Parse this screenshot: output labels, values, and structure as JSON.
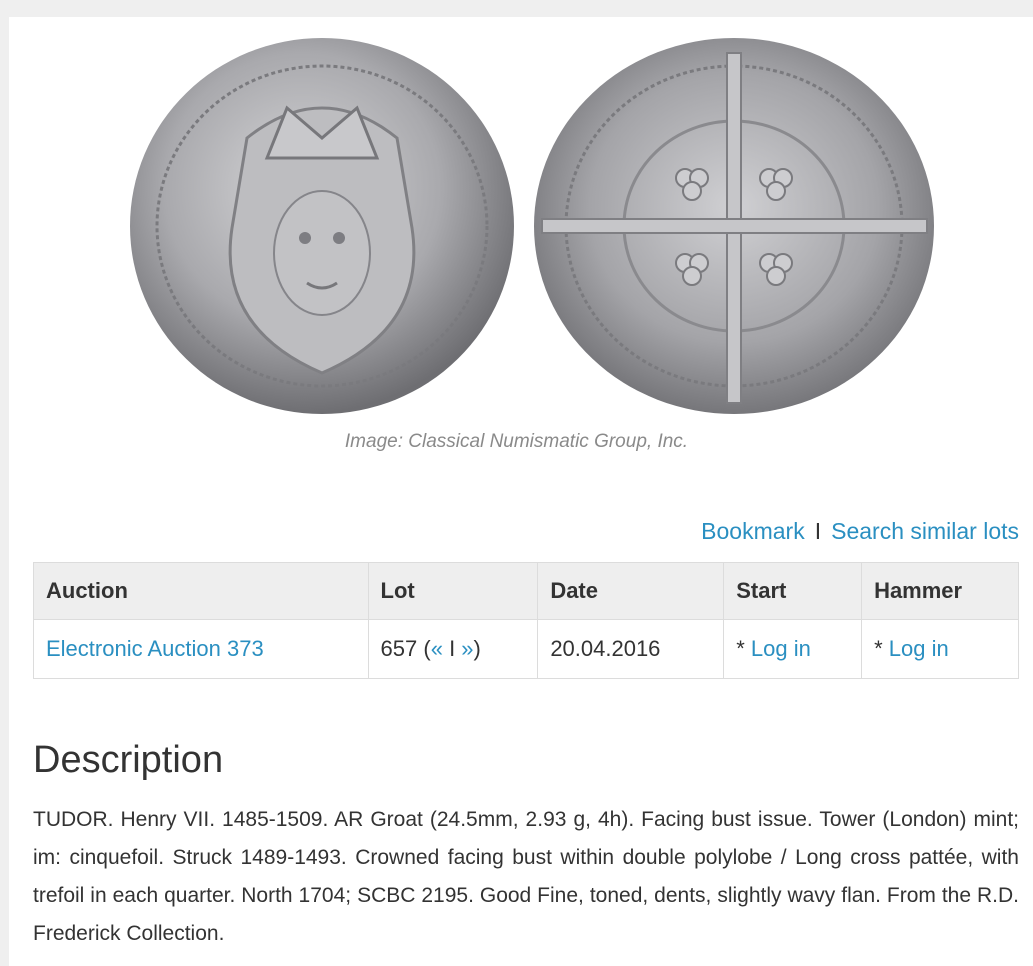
{
  "image": {
    "caption": "Image: Classical Numismatic Group, Inc."
  },
  "actions": {
    "bookmark": "Bookmark",
    "separator": "I",
    "search_similar": "Search similar lots"
  },
  "table": {
    "headers": [
      "Auction",
      "Lot",
      "Date",
      "Start",
      "Hammer"
    ],
    "row": {
      "auction": "Electronic Auction 373",
      "lot_number": "657 (",
      "lot_prev": "«",
      "lot_sep": " I ",
      "lot_next": "»",
      "lot_close": ")",
      "date": "20.04.2016",
      "start_prefix": "* ",
      "start_link": "Log in",
      "hammer_prefix": "* ",
      "hammer_link": "Log in"
    }
  },
  "description": {
    "title": "Description",
    "text": "TUDOR. Henry VII. 1485-1509. AR Groat (24.5mm, 2.93 g, 4h). Facing bust issue. Tower (London) mint; im: cinquefoil. Struck 1489-1493. Crowned facing bust within double polylobe / Long cross pattée, with trefoil in each quarter. North 1704; SCBC 2195. Good Fine, toned, dents, slightly wavy flan. From the R.D. Frederick Collection."
  },
  "colors": {
    "link": "#2a8fc1",
    "text": "#333333",
    "header_bg": "#eeeeee",
    "coin_silver": "#b9b9bc"
  }
}
